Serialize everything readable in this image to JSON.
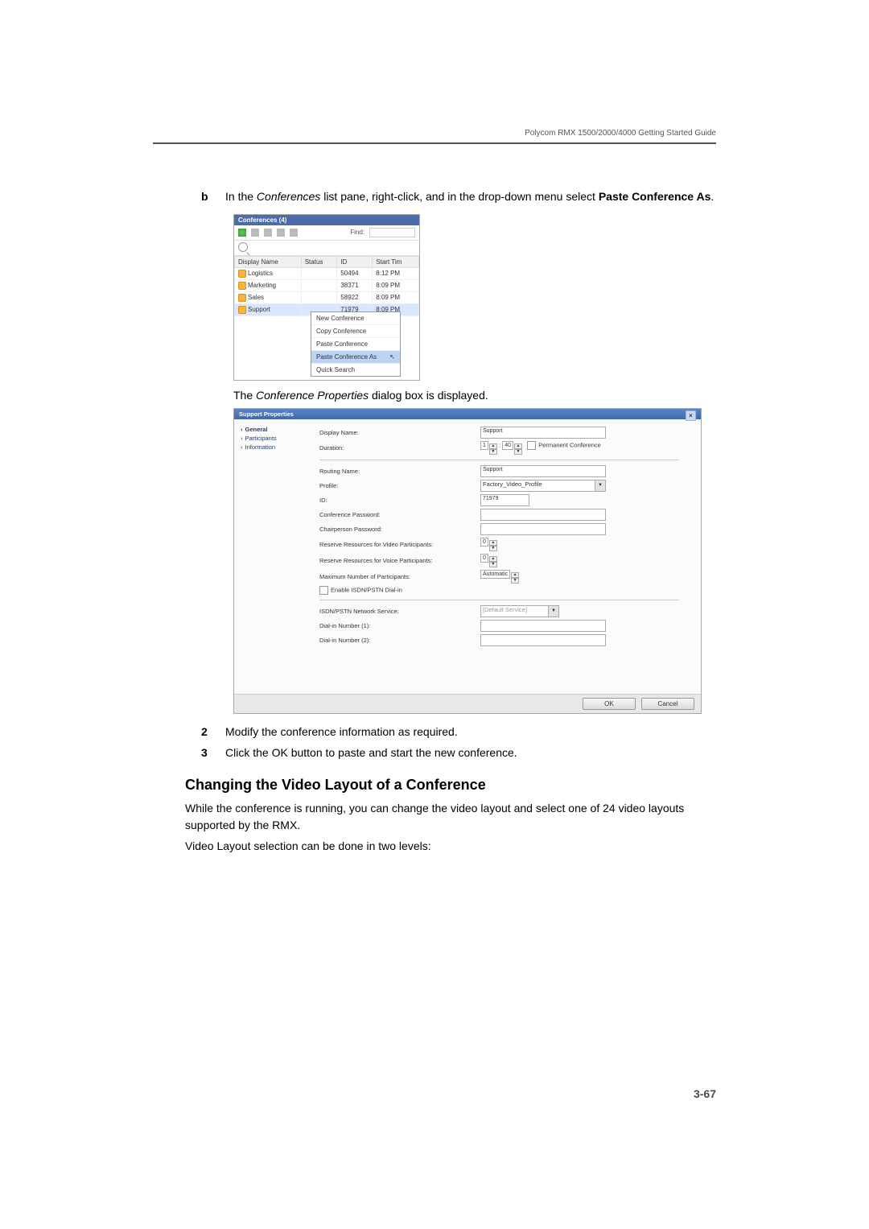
{
  "header": {
    "title": "Polycom RMX 1500/2000/4000 Getting Started Guide"
  },
  "body": {
    "step_b": {
      "letter": "b",
      "pre": "In the ",
      "ital": "Conferences",
      "mid": " list pane, right-click, and in the drop-down menu select ",
      "bold": "Paste Conference As",
      "post": "."
    },
    "caption": {
      "pre": "The ",
      "ital": "Conference Properties",
      "post": " dialog box is displayed."
    },
    "step2": {
      "n": "2",
      "text": "Modify the conference information as required."
    },
    "step3": {
      "n": "3",
      "text": "Click the OK button to paste and start the new conference."
    },
    "section_heading": "Changing the Video Layout of a Conference",
    "para1": "While the conference is running, you can change the video layout and select one of 24 video layouts supported by the RMX.",
    "para2": "Video Layout selection can be done in two levels:"
  },
  "conferences": {
    "title": "Conferences (4)",
    "find_label": "Find:",
    "columns": [
      "Display Name",
      "Status",
      "ID",
      "Start Tim"
    ],
    "rows": [
      {
        "name": "Logistics",
        "status": "",
        "id": "50494",
        "start": "8:12 PM"
      },
      {
        "name": "Marketing",
        "status": "",
        "id": "38371",
        "start": "8:09 PM"
      },
      {
        "name": "Sales",
        "status": "",
        "id": "58922",
        "start": "8:09 PM"
      },
      {
        "name": "Support",
        "status": "",
        "id": "71979",
        "start": "8:09 PM"
      }
    ],
    "ctx": [
      "New Conference",
      "Copy Conference",
      "Paste Conference",
      "Paste Conference As",
      "Quick Search"
    ]
  },
  "dialog": {
    "title": "Support Properties",
    "nav": [
      "General",
      "Participants",
      "Information"
    ],
    "labels": {
      "display_name": "Display Name:",
      "duration": "Duration:",
      "permanent": "Permanent Conference",
      "routing": "Routing Name:",
      "profile": "Profile:",
      "id": "ID:",
      "conf_pwd": "Conference Password:",
      "chair_pwd": "Chairperson Password:",
      "res_video": "Reserve Resources for Video Participants:",
      "res_voice": "Reserve Resources for Voice Participants:",
      "max_part": "Maximum Number of Participants:",
      "enable_isdn": "Enable ISDN/PSTN Dial-in",
      "isdn_svc": "ISDN/PSTN Network Service:",
      "dialin1": "Dial-in Number (1):",
      "dialin2": "Dial-in Number (2):"
    },
    "values": {
      "display_name": "Support",
      "duration_h": "1",
      "duration_m": "40",
      "routing": "Support",
      "profile": "Factory_Video_Profile",
      "id": "71979",
      "res_video": "0",
      "res_voice": "0",
      "max_part": "Automatic",
      "isdn_svc": "[Default Service]"
    },
    "buttons": {
      "ok": "OK",
      "cancel": "Cancel"
    }
  },
  "footer": {
    "page": "3-67"
  }
}
